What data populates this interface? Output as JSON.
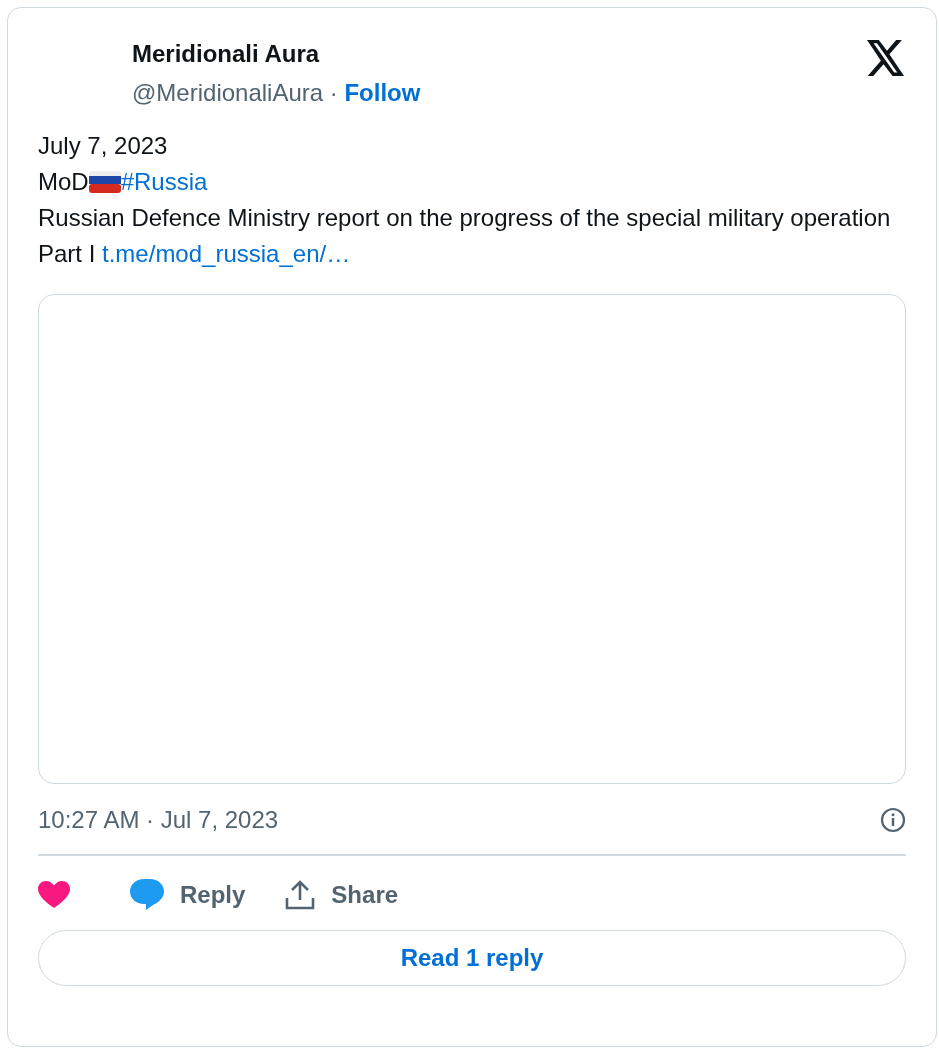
{
  "author": {
    "name": "Meridionali Aura",
    "handle": "@MeridionaliAura",
    "separator": "·",
    "follow": "Follow"
  },
  "body": [
    {
      "segments": [
        {
          "kind": "text",
          "text": "July 7, 2023"
        }
      ]
    },
    {
      "segments": [
        {
          "kind": "text",
          "text": "MoD"
        },
        {
          "kind": "flag"
        },
        {
          "kind": "link",
          "text": "#Russia"
        }
      ]
    },
    {
      "segments": [
        {
          "kind": "text",
          "text": "Russian Defence Ministry report on the progress of the special military operation"
        }
      ]
    },
    {
      "segments": [
        {
          "kind": "text",
          "text": "Part I"
        },
        {
          "kind": "link",
          "text": "t.me/mod_russia_en/…"
        }
      ]
    }
  ],
  "timestamp": "10:27 AM · Jul 7, 2023",
  "actions": [
    {
      "kind": "like"
    },
    {
      "kind": "reply",
      "label": "Reply"
    },
    {
      "kind": "share",
      "label": "Share"
    }
  ],
  "read_replies": "Read 1 reply"
}
